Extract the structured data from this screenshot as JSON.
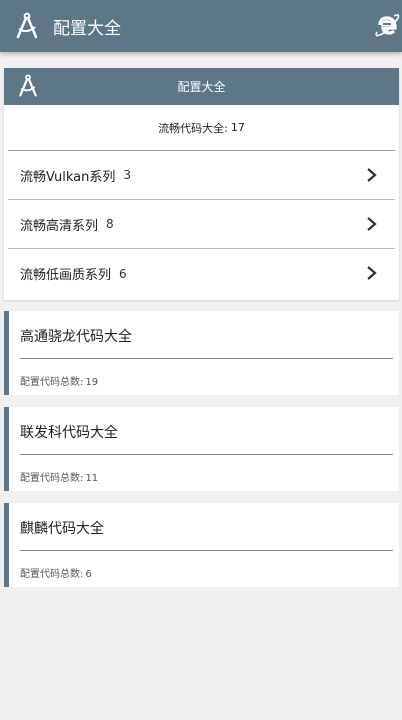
{
  "appbar": {
    "title": "配置大全",
    "logo_icon": "compass-icon",
    "browser_icon": "browser-e-icon"
  },
  "panel": {
    "title": "配置大全",
    "total_label": "流畅代码大全:",
    "total_count": "17",
    "series": [
      {
        "name": "流畅Vulkan系列",
        "count": "3"
      },
      {
        "name": "流畅高清系列",
        "count": "8"
      },
      {
        "name": "流畅低画质系列",
        "count": "6"
      }
    ]
  },
  "cards": [
    {
      "title": "高通骁龙代码大全",
      "meta_label": "配置代码总数:",
      "meta_count": "19"
    },
    {
      "title": "联发科代码大全",
      "meta_label": "配置代码总数:",
      "meta_count": "11"
    },
    {
      "title": "麒麟代码大全",
      "meta_label": "配置代码总数:",
      "meta_count": "6"
    }
  ],
  "colors": {
    "primary": "#5d7786",
    "background": "#f0f0f0",
    "browser_icon": "#2a8fd8"
  }
}
